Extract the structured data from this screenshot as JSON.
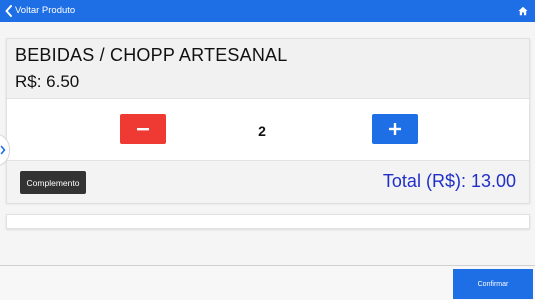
{
  "topbar": {
    "back_label": "Voltar Produto",
    "back_icon": "chevron-left-icon",
    "home_icon": "home-icon",
    "color": "#1e6ee6"
  },
  "product": {
    "name": "BEBIDAS / CHOPP ARTESANAL",
    "price": "R$: 6.50"
  },
  "quantity": {
    "value": "2",
    "decrement_icon": "minus-icon",
    "increment_icon": "plus-icon",
    "decrement_color": "#ee3a33",
    "increment_color": "#1e6ee6"
  },
  "footer": {
    "complemento_label": "Complemento",
    "total": "Total (R$): 13.00",
    "total_color": "#1f2fc7"
  },
  "side_handle_icon": "chevron-right-icon",
  "bottombar": {
    "confirm_label": "Confirmar"
  }
}
